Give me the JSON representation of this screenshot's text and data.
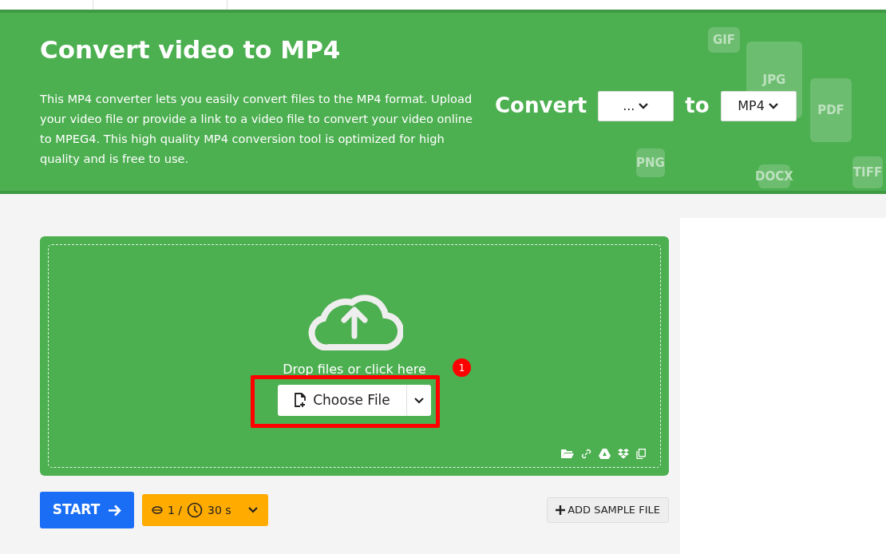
{
  "header": {
    "title": "Convert video to MP4",
    "description": "This MP4 converter lets you easily convert files to the MP4 format. Upload your video file or provide a link to a video file to convert your video online to MPEG4. This high quality MP4 conversion tool is optimized for high quality and is free to use.",
    "convert_label": "Convert",
    "from_select": "...",
    "to_label": "to",
    "to_select": "MP4",
    "background_icons": [
      "GIF",
      "JPG",
      "PDF",
      "PNG",
      "DOCX",
      "TIFF"
    ]
  },
  "upload": {
    "drop_text": "Drop files or click here",
    "choose_button": "Choose File",
    "annotation_number": "1"
  },
  "actions": {
    "start": "START",
    "credits": "1 /",
    "time": "30 s",
    "add_sample": "ADD SAMPLE FILE"
  }
}
